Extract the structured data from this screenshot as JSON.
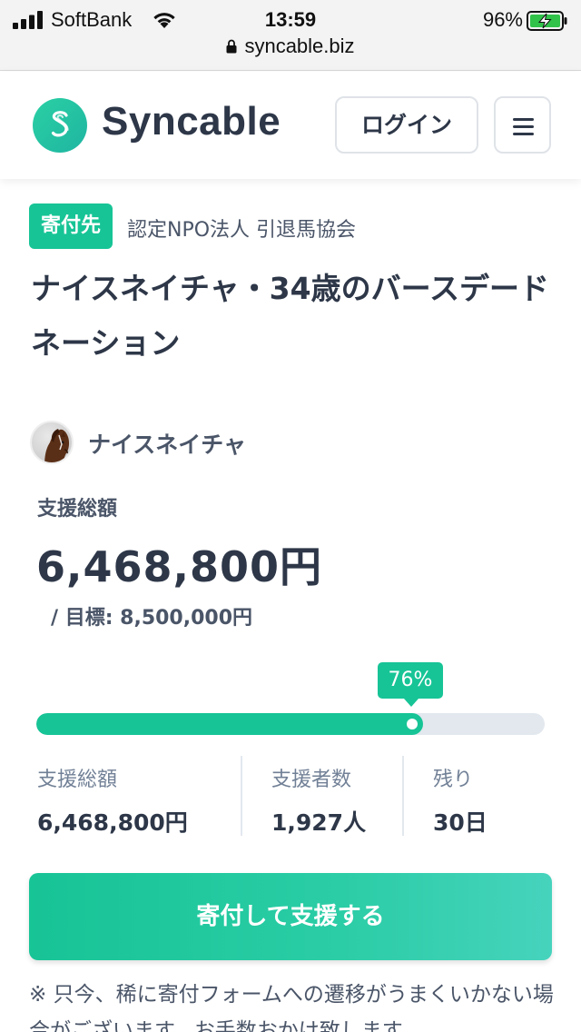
{
  "status_bar": {
    "carrier": "SoftBank",
    "time": "13:59",
    "battery_percent": "96%",
    "url": "syncable.biz"
  },
  "header": {
    "brand": "Syncable",
    "login_label": "ログイン",
    "menu_icon": "hamburger-menu-icon",
    "brand_color": "#1fc09e"
  },
  "project": {
    "badge": "寄付先",
    "organization": "認定NPO法人 引退馬協会",
    "title": "ナイスネイチャ・34歳のバースデードネーション",
    "owner_name": "ナイスネイチャ"
  },
  "funding": {
    "total_label": "支援総額",
    "total_amount": "6,468,800円",
    "goal_text": "/ 目標: 8,500,000円",
    "progress_label": "76%",
    "progress_fraction": 0.76
  },
  "stats": [
    {
      "label": "支援総額",
      "value": "6,468,800円"
    },
    {
      "label": "支援者数",
      "value": "1,927人"
    },
    {
      "label": "残り",
      "value": "30日"
    }
  ],
  "cta": {
    "donate_label": "寄付して支援する"
  },
  "notice": {
    "text": "※ 只今、稀に寄付フォームへの遷移がうまくいかない場合がございます。お手数おかけ致します"
  },
  "colors": {
    "accent": "#17c496",
    "track": "#e2e8ee",
    "text": "#2d3748"
  }
}
